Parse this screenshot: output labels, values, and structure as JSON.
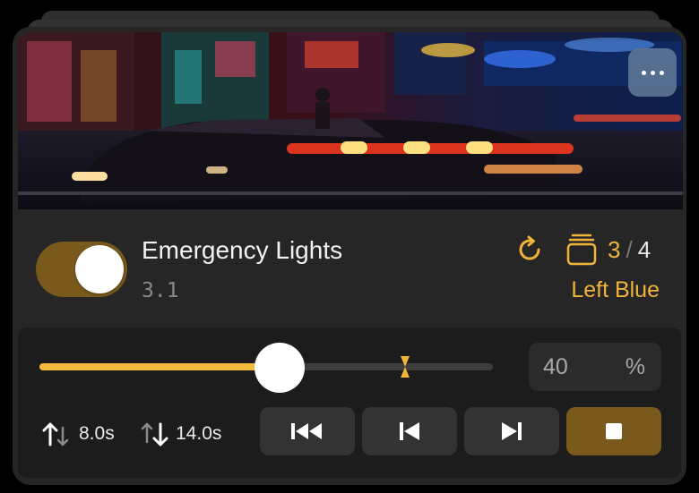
{
  "light": {
    "title": "Emergency Lights",
    "version": "3.1",
    "enabled": true,
    "scene_index": "3",
    "scene_separator": "/",
    "scene_total": "4",
    "scene_name": "Left Blue"
  },
  "controls": {
    "brightness_percent": 40,
    "brightness_value": "40",
    "brightness_unit": "%",
    "slider_fill_fraction": 0.53,
    "fade_up_label": "8.0s",
    "fade_down_label": "14.0s"
  },
  "icons": {
    "more": "more-horizontal",
    "sync": "refresh-circular-arrow",
    "scenes": "stacked-layers",
    "marker": "hourglass",
    "fade_up": "arrow-up-arrow-down-up-emphasis",
    "fade_down": "arrow-up-arrow-down-down-emphasis",
    "first": "skip-to-start",
    "previous": "skip-previous",
    "next": "skip-next",
    "stop": "stop-square"
  },
  "colors": {
    "accent": "#f0b43a",
    "toggle_on": "#7a5a1c",
    "card": "#262626",
    "panel": "#1c1c1c"
  }
}
